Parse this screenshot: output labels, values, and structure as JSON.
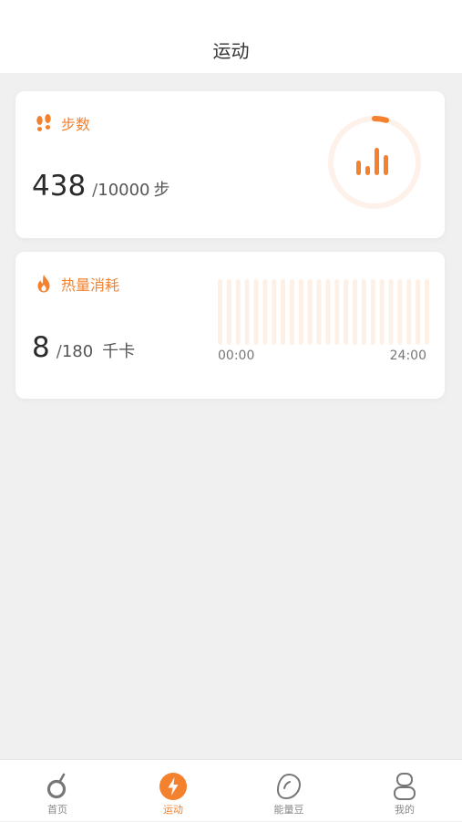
{
  "header": {
    "title": "运动"
  },
  "steps": {
    "label": "步数",
    "value": "438",
    "separator": "/",
    "goal": "10000",
    "unit": "步",
    "progress_fraction": 0.0438
  },
  "calories": {
    "label": "热量消耗",
    "value": "8",
    "separator": "/",
    "goal": "180",
    "unit": "千卡",
    "time_start": "00:00",
    "time_end": "24:00"
  },
  "tabs": [
    {
      "label": "首页",
      "icon": "fruit-icon",
      "active": false
    },
    {
      "label": "运动",
      "icon": "lightning-icon",
      "active": true
    },
    {
      "label": "能量豆",
      "icon": "bean-icon",
      "active": false
    },
    {
      "label": "我的",
      "icon": "person-icon",
      "active": false
    }
  ],
  "colors": {
    "accent": "#f3812e",
    "ring_track": "#fdf1ea",
    "bar_track": "#fdf0e6",
    "background": "#f0f0f0"
  }
}
